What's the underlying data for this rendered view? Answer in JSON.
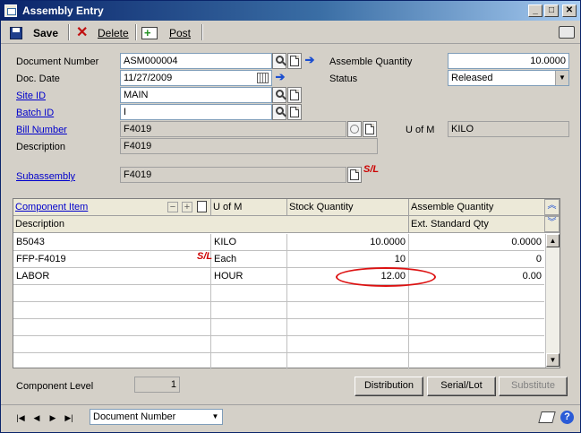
{
  "window": {
    "title": "Assembly Entry"
  },
  "toolbar": {
    "save_label": "Save",
    "delete_label": "Delete",
    "post_label": "Post"
  },
  "form": {
    "document_number": {
      "label": "Document Number",
      "value": "ASM000004"
    },
    "doc_date": {
      "label": "Doc. Date",
      "value": "11/27/2009"
    },
    "site_id": {
      "label": "Site ID",
      "value": "MAIN"
    },
    "batch_id": {
      "label": "Batch ID",
      "value": "I"
    },
    "bill_number": {
      "label": "Bill Number",
      "value": "F4019"
    },
    "description": {
      "label": "Description",
      "value": "F4019"
    },
    "subassembly": {
      "label": "Subassembly",
      "value": "F4019",
      "sl_marker": "S/L"
    },
    "assemble_quantity": {
      "label": "Assemble Quantity",
      "value": "10.0000"
    },
    "status": {
      "label": "Status",
      "value": "Released"
    },
    "u_of_m": {
      "label": "U of M",
      "value": "KILO"
    }
  },
  "grid": {
    "headers": {
      "component_item": "Component Item",
      "u_of_m": "U of M",
      "stock_quantity": "Stock Quantity",
      "assemble_quantity": "Assemble Quantity",
      "description": "Description",
      "ext_standard_qty": "Ext. Standard Qty"
    },
    "rows": [
      {
        "item": "B5043",
        "sl": "",
        "uom": "KILO",
        "stock": "10.0000",
        "assemble": "0.0000"
      },
      {
        "item": "FFP-F4019",
        "sl": "S/L",
        "uom": "Each",
        "stock": "10",
        "assemble": "0"
      },
      {
        "item": "LABOR",
        "sl": "",
        "uom": "HOUR",
        "stock": "12.00",
        "assemble": "0.00"
      },
      {
        "item": "",
        "sl": "",
        "uom": "",
        "stock": "",
        "assemble": ""
      },
      {
        "item": "",
        "sl": "",
        "uom": "",
        "stock": "",
        "assemble": ""
      },
      {
        "item": "",
        "sl": "",
        "uom": "",
        "stock": "",
        "assemble": ""
      },
      {
        "item": "",
        "sl": "",
        "uom": "",
        "stock": "",
        "assemble": ""
      },
      {
        "item": "",
        "sl": "",
        "uom": "",
        "stock": "",
        "assemble": ""
      }
    ]
  },
  "component_level": {
    "label": "Component Level",
    "value": "1"
  },
  "buttons": {
    "distribution": "Distribution",
    "serial_lot": "Serial/Lot",
    "substitute": "Substitute"
  },
  "statusbar": {
    "sort_value": "Document Number"
  },
  "colors": {
    "link": "#0000cc",
    "title_bar": "#0a246a",
    "highlight_ellipse": "#dd1111"
  }
}
